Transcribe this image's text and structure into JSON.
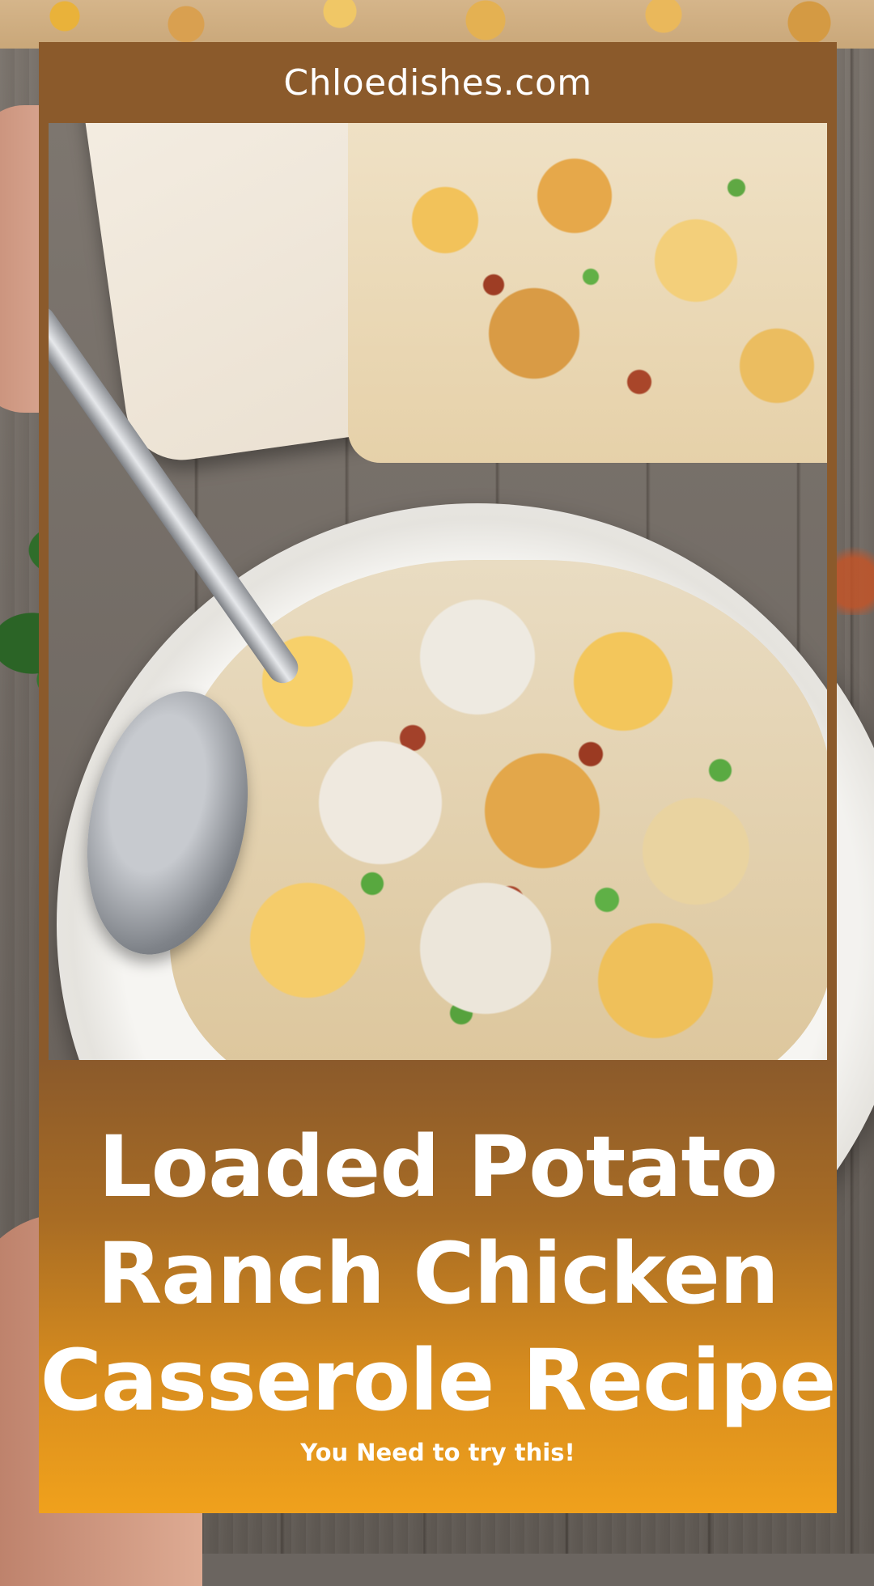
{
  "header": {
    "site_name": "Chloedishes.com"
  },
  "recipe": {
    "title_lines": [
      "Loaded Potato",
      "Ranch Chicken",
      "Casserole Recipe"
    ],
    "tagline": "You Need to try this!"
  },
  "colors": {
    "frame_brown": "#8b5a2b",
    "panel_orange": "#f0a11c",
    "text": "#ffffff"
  },
  "images": {
    "hero": "food-photo"
  }
}
